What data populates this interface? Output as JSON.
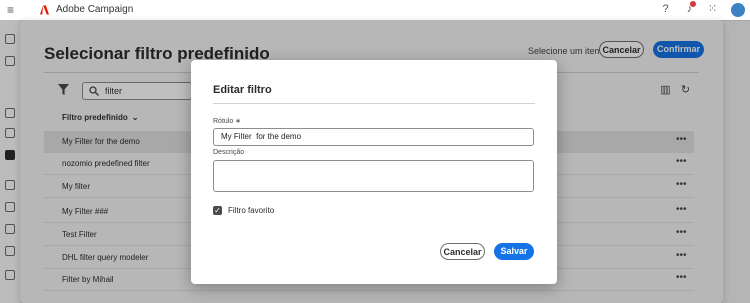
{
  "app": {
    "name": "Adobe Campaign"
  },
  "outer": {
    "title": "Selecionar filtro predefinido",
    "selection_status": "Selecione um item",
    "cancel_label": "Cancelar",
    "confirm_label": "Confirmar",
    "search_value": "filter",
    "column_header": "Filtro predefinido",
    "rows": [
      {
        "label": "My Filter for the demo"
      },
      {
        "label": "nozomio predefined filter"
      },
      {
        "label": "My filter"
      },
      {
        "label": "My Filter ###"
      },
      {
        "label": "Test Filter"
      },
      {
        "label": "DHL filter query modeler"
      },
      {
        "label": "Filter by Mihail"
      }
    ],
    "more_glyph": "•••"
  },
  "modal": {
    "title": "Editar filtro",
    "label_field_label": "Rótulo ∗",
    "label_value": "My Filter  for the demo",
    "description_label": "Descrição",
    "description_value": "",
    "favorite_label": "Filtro favorito",
    "favorite_checked": true,
    "cancel_label": "Cancelar",
    "save_label": "Salvar"
  },
  "colors": {
    "accent": "#1473e6",
    "brand": "#eb1000"
  },
  "icons": [
    "menu-icon",
    "adobe-logo-icon",
    "help-icon",
    "notifications-icon",
    "apps-grid-icon",
    "avatar",
    "filter-icon",
    "search-icon",
    "columns-icon",
    "refresh-icon",
    "more-icon"
  ]
}
